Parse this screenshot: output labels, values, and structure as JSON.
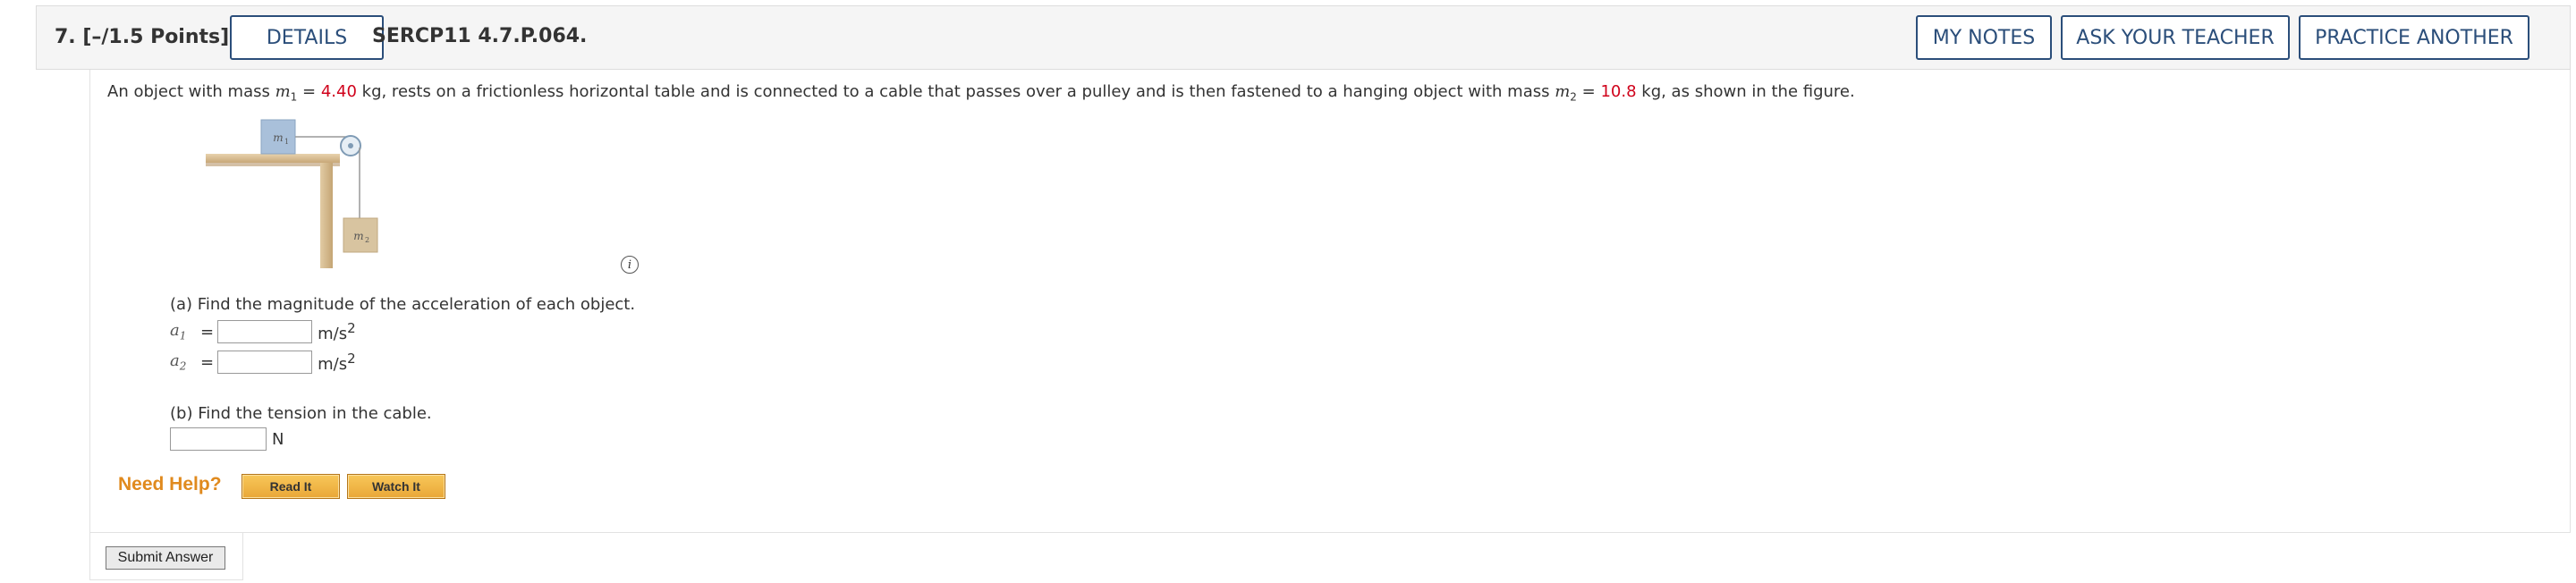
{
  "header": {
    "question_number": "7.",
    "points": "[–/1.5 Points]",
    "details_label": "DETAILS",
    "problem_code": "SERCP11 4.7.P.064.",
    "my_notes_label": "MY NOTES",
    "ask_teacher_label": "ASK YOUR TEACHER",
    "practice_label": "PRACTICE ANOTHER"
  },
  "question": {
    "text_1": "An object with mass ",
    "m1_symbol": "m",
    "m1_sub": "1",
    "text_2": " = ",
    "m1_value": "4.40",
    "text_3": " kg, rests on a frictionless horizontal table and is connected to a cable that passes over a pulley and is then fastened to a hanging object with mass ",
    "m2_symbol": "m",
    "m2_sub": "2",
    "text_4": " = ",
    "m2_value": "10.8",
    "text_5": " kg, as shown in the figure."
  },
  "figure": {
    "m1_label": "m1",
    "m2_label": "m2",
    "info_icon": "i"
  },
  "part_a": {
    "prompt": "(a) Find the magnitude of the acceleration of each object.",
    "a1_symbol": "a",
    "a1_sub": "1",
    "a2_symbol": "a",
    "a2_sub": "2",
    "equals": "=",
    "unit_base": "m/s",
    "unit_exp": "2"
  },
  "part_b": {
    "prompt": "(b) Find the tension in the cable.",
    "unit": "N"
  },
  "help": {
    "label": "Need Help?",
    "read_it": "Read It",
    "watch_it": "Watch It"
  },
  "submit_label": "Submit Answer",
  "colors": {
    "accent_blue": "#2b4e7a",
    "given_value_red": "#d0021b",
    "help_orange": "#e08a1e"
  }
}
